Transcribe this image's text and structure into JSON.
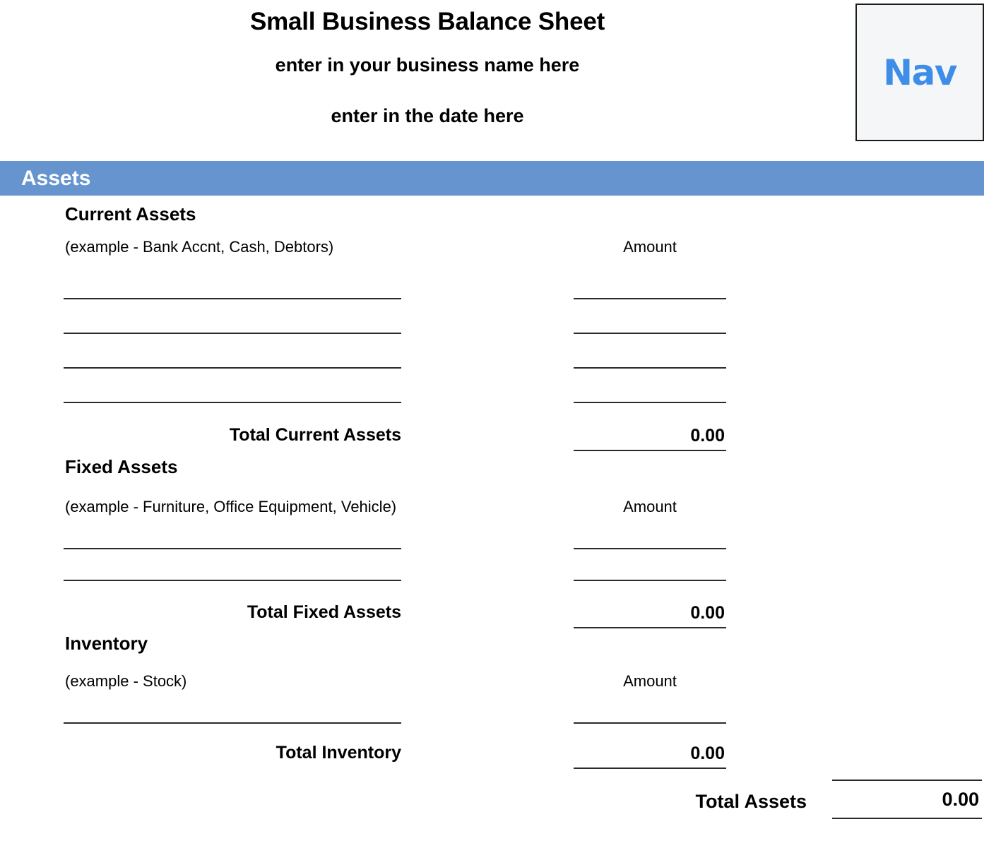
{
  "header": {
    "title": "Small Business Balance Sheet",
    "business_name_placeholder": "enter in your business name here",
    "date_placeholder": "enter in the date here",
    "logo": {
      "text": "Nav",
      "color": "#3e8ee8",
      "background": "#f5f6f8",
      "border_color": "#1b1b1b"
    }
  },
  "banner": {
    "label": "Assets",
    "background": "#6694cf",
    "text_color": "#ffffff"
  },
  "amount_column_header": "Amount",
  "sections": [
    {
      "heading": "Current Assets",
      "example": "(example - Bank Accnt, Cash, Debtors)",
      "amount_header": "Amount",
      "blank_rows": 4,
      "total_label": "Total Current Assets",
      "total_value": "0.00"
    },
    {
      "heading": "Fixed Assets",
      "example": "(example - Furniture, Office Equipment, Vehicle)",
      "amount_header": "Amount",
      "blank_rows": 2,
      "total_label": "Total Fixed Assets",
      "total_value": "0.00"
    },
    {
      "heading": "Inventory",
      "example": "(example - Stock)",
      "amount_header": "Amount",
      "blank_rows": 1,
      "total_label": "Total Inventory",
      "total_value": "0.00"
    }
  ],
  "grand_total": {
    "label": "Total Assets",
    "value": "0.00"
  }
}
